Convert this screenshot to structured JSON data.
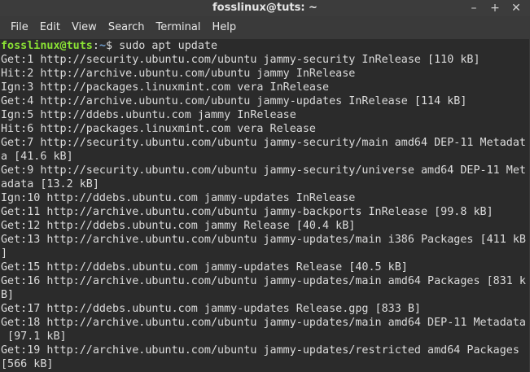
{
  "window": {
    "title": "fosslinux@tuts: ~",
    "controls": {
      "minimize": "–",
      "maximize": "+",
      "close": "✕"
    }
  },
  "menu": {
    "items": [
      "File",
      "Edit",
      "View",
      "Search",
      "Terminal",
      "Help"
    ]
  },
  "terminal": {
    "prompt": {
      "user_host": "fosslinux@tuts",
      "separator": ":",
      "path": "~",
      "symbol": "$ ",
      "command": "sudo apt update"
    },
    "lines": [
      "Get:1 http://security.ubuntu.com/ubuntu jammy-security InRelease [110 kB]",
      "Hit:2 http://archive.ubuntu.com/ubuntu jammy InRelease",
      "Ign:3 http://packages.linuxmint.com vera InRelease",
      "Get:4 http://archive.ubuntu.com/ubuntu jammy-updates InRelease [114 kB]",
      "Ign:5 http://ddebs.ubuntu.com jammy InRelease",
      "Hit:6 http://packages.linuxmint.com vera Release",
      "Get:7 http://security.ubuntu.com/ubuntu jammy-security/main amd64 DEP-11 Metadat",
      "a [41.6 kB]",
      "Get:9 http://security.ubuntu.com/ubuntu jammy-security/universe amd64 DEP-11 Met",
      "adata [13.2 kB]",
      "Ign:10 http://ddebs.ubuntu.com jammy-updates InRelease",
      "Get:11 http://archive.ubuntu.com/ubuntu jammy-backports InRelease [99.8 kB]",
      "Get:12 http://ddebs.ubuntu.com jammy Release [40.4 kB]",
      "Get:13 http://archive.ubuntu.com/ubuntu jammy-updates/main i386 Packages [411 kB",
      "]",
      "Get:15 http://ddebs.ubuntu.com jammy-updates Release [40.5 kB]",
      "Get:16 http://archive.ubuntu.com/ubuntu jammy-updates/main amd64 Packages [831 k",
      "B]",
      "Get:17 http://ddebs.ubuntu.com jammy-updates Release.gpg [833 B]",
      "Get:18 http://archive.ubuntu.com/ubuntu jammy-updates/main amd64 DEP-11 Metadata",
      " [97.1 kB]",
      "Get:19 http://archive.ubuntu.com/ubuntu jammy-updates/restricted amd64 Packages",
      "[566 kB]"
    ]
  },
  "colors": {
    "background": "#2b2b2b",
    "titlebar": "#3c3c3c",
    "menubar": "#3a3a3a",
    "text": "#dcdcdc",
    "prompt_user": "#8ae234",
    "prompt_path": "#729fcf"
  }
}
